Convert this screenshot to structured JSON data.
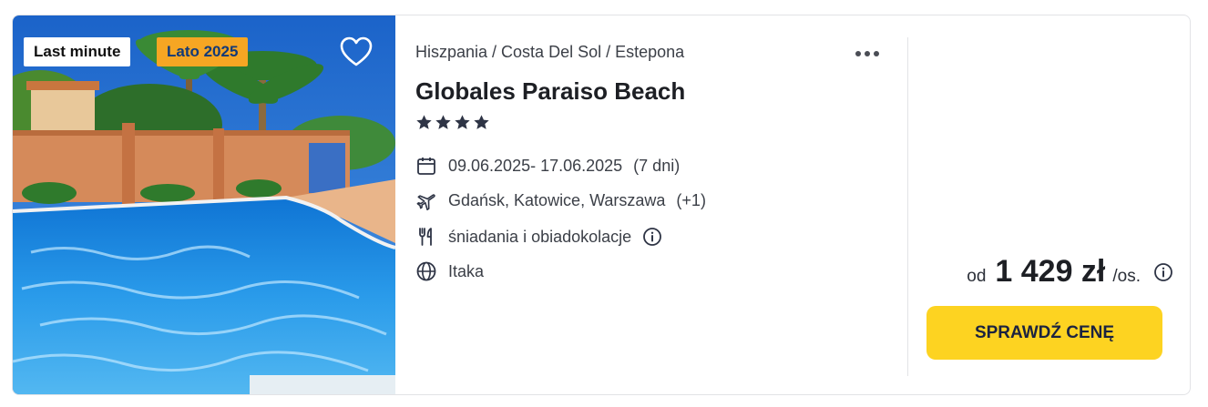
{
  "offer": {
    "badges": {
      "last_minute": "Last minute",
      "season": "Lato 2025"
    },
    "breadcrumb": "Hiszpania / Costa Del Sol / Estepona",
    "hotel_name": "Globales Paraiso Beach",
    "stars": 4,
    "details": {
      "dates": "09.06.2025- 17.06.2025",
      "duration": "(7 dni)",
      "departures": "Gdańsk, Katowice, Warszawa",
      "departures_more": "(+1)",
      "board": "śniadania i obiadokolacje",
      "operator": "Itaka"
    },
    "price": {
      "from": "od",
      "amount": "1 429 zł",
      "per": "/os."
    },
    "cta_label": "SPRAWDŹ CENĘ"
  },
  "icons": {
    "favorite": "heart-outline-icon",
    "more": "more-dots-icon",
    "star": "star-icon",
    "calendar": "calendar-icon",
    "flight": "plane-icon",
    "meals": "fork-knife-icon",
    "operator": "globe-icon",
    "info": "info-circle-icon"
  },
  "colors": {
    "season_badge_bg": "#f6a623",
    "season_badge_text": "#123a78",
    "cta_bg": "#fdd321",
    "text_primary": "#1d1f24",
    "pool_water": "#1f8de0"
  }
}
